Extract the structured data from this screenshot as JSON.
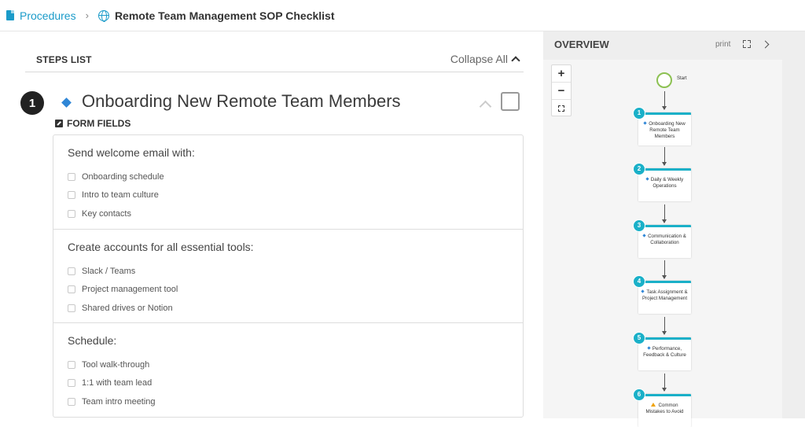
{
  "breadcrumb": {
    "parent": "Procedures",
    "separator": "›",
    "title": "Remote Team Management SOP Checklist"
  },
  "steps_list": {
    "title": "STEPS LIST",
    "collapse_label": "Collapse All"
  },
  "step": {
    "number": "1",
    "title": "Onboarding New Remote Team Members",
    "form_fields_label": "FORM FIELDS",
    "groups": [
      {
        "title": "Send welcome email with:",
        "items": [
          "Onboarding schedule",
          "Intro to team culture",
          "Key contacts"
        ]
      },
      {
        "title": "Create accounts for all essential tools:",
        "items": [
          "Slack / Teams",
          "Project management tool",
          "Shared drives or Notion"
        ]
      },
      {
        "title": "Schedule:",
        "items": [
          "Tool walk-through",
          "1:1 with team lead",
          "Team intro meeting"
        ]
      }
    ]
  },
  "overview": {
    "title": "OVERVIEW",
    "print_label": "print",
    "zoom_in": "+",
    "zoom_out": "−",
    "start_label": "Start",
    "nodes": [
      {
        "num": "1",
        "label": "Onboarding New Remote Team Members",
        "icon": "diamond"
      },
      {
        "num": "2",
        "label": "Daily & Weekly Operations",
        "icon": "diamond"
      },
      {
        "num": "3",
        "label": "Communication & Collaboration",
        "icon": "diamond"
      },
      {
        "num": "4",
        "label": "Task Assignment & Project Management",
        "icon": "diamond"
      },
      {
        "num": "5",
        "label": "Performance, Feedback & Culture",
        "icon": "diamond"
      },
      {
        "num": "6",
        "label": "Common Mistakes to Avoid",
        "icon": "warning"
      }
    ]
  },
  "colors": {
    "accent": "#1a9bc9",
    "node_accent": "#1ab0c8",
    "start_ring": "#8cc152",
    "diamond": "#2f86d6"
  }
}
